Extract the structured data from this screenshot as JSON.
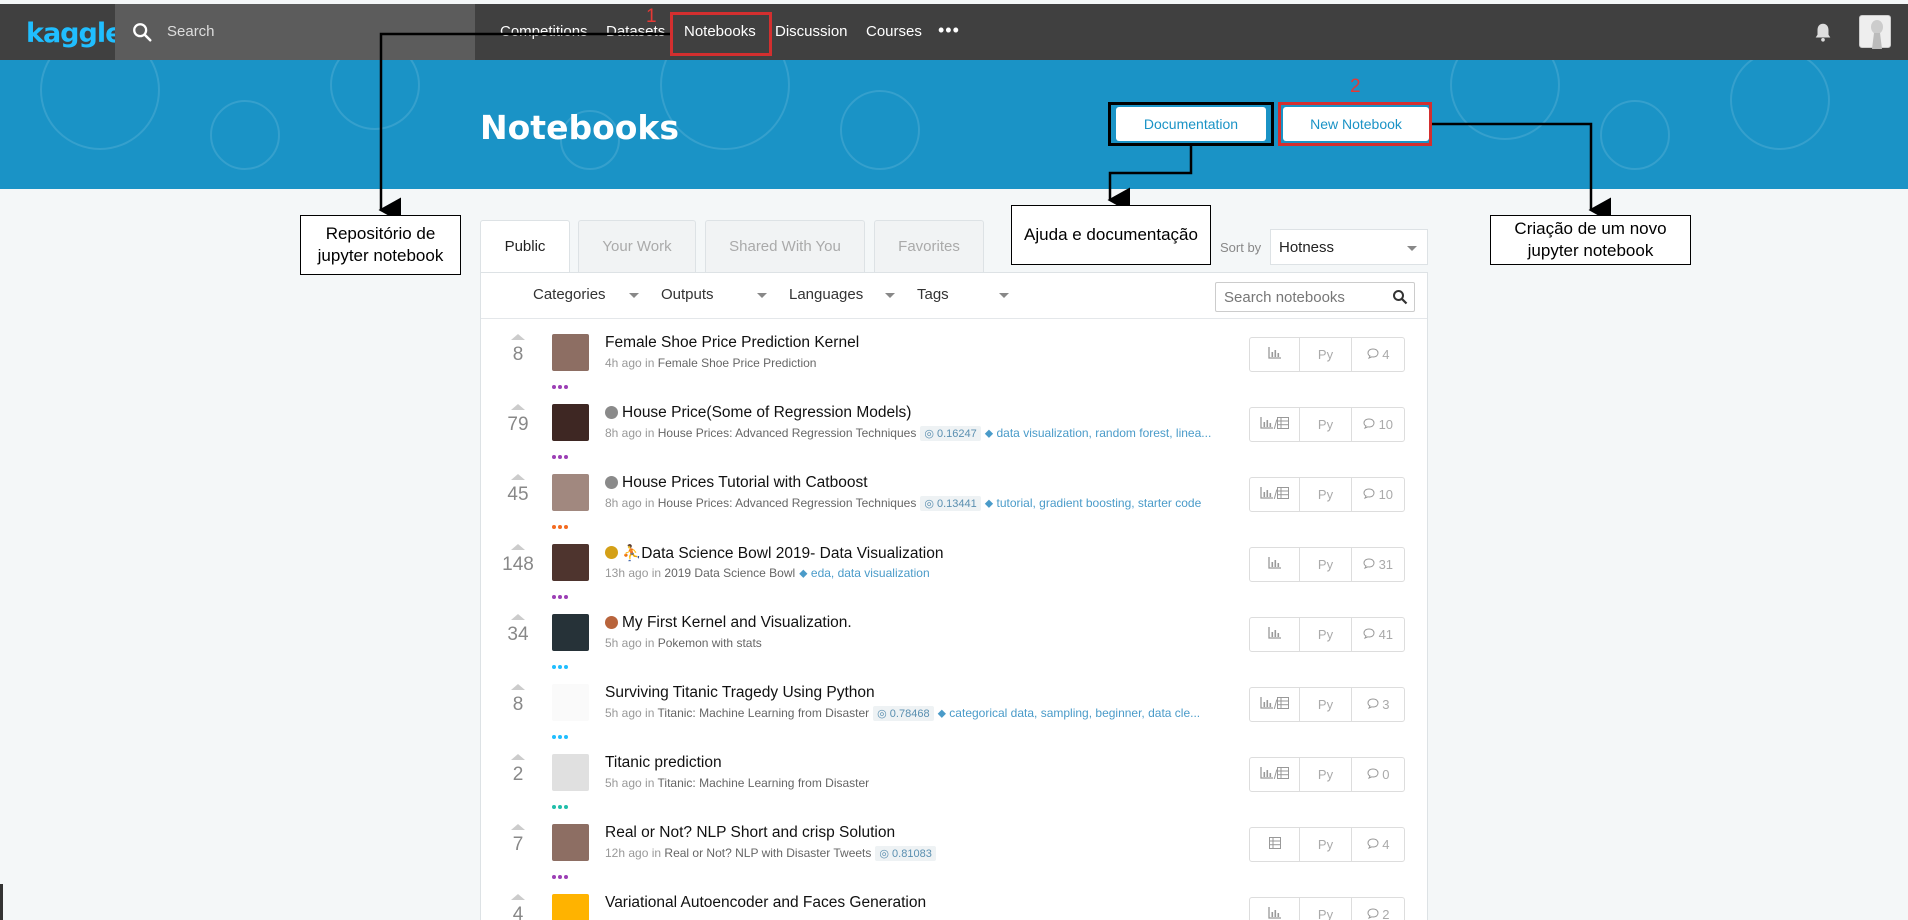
{
  "topbar": {
    "logo": "kaggle",
    "search_placeholder": "Search",
    "nav": [
      "Competitions",
      "Datasets",
      "Notebooks",
      "Discussion",
      "Courses"
    ],
    "more_label": "•••"
  },
  "hero": {
    "title": "Notebooks",
    "documentation_label": "Documentation",
    "new_notebook_label": "New Notebook"
  },
  "annotations": {
    "num1": "1",
    "num2": "2",
    "repo_line1": "Repositório de",
    "repo_line2": "jupyter notebook",
    "help": "Ajuda e documentação",
    "create_line1": "Criação de um novo",
    "create_line2": "jupyter notebook"
  },
  "tabs": [
    "Public",
    "Your Work",
    "Shared With You",
    "Favorites"
  ],
  "sort": {
    "label": "Sort by",
    "value": "Hotness"
  },
  "filters": [
    "Categories",
    "Outputs",
    "Languages",
    "Tags"
  ],
  "search_notebooks_placeholder": "Search notebooks",
  "notebooks": [
    {
      "votes": "8",
      "title": "Female Shoe Price Prediction Kernel",
      "time": "4h ago in",
      "competition": "Female Shoe Price Prediction",
      "score": "",
      "tags": "",
      "stats_icon": "chart",
      "lang": "Py",
      "comments": "4",
      "medal": "",
      "tier_color": "#9c3fb5"
    },
    {
      "votes": "79",
      "title": "House Price(Some of Regression Models)",
      "time": "8h ago in",
      "competition": "House Prices: Advanced Regression Techniques",
      "score": "0.16247",
      "tags": "data visualization, random forest, linea...",
      "stats_icon": "chart+table",
      "lang": "Py",
      "comments": "10",
      "medal": "silver",
      "tier_color": "#9c3fb5"
    },
    {
      "votes": "45",
      "title": "House Prices Tutorial with Catboost",
      "time": "8h ago in",
      "competition": "House Prices: Advanced Regression Techniques",
      "score": "0.13441",
      "tags": "tutorial, gradient boosting, starter code",
      "stats_icon": "chart+table",
      "lang": "Py",
      "comments": "10",
      "medal": "silver",
      "tier_color": "#f36b21"
    },
    {
      "votes": "148",
      "title": "⛹Data Science Bowl 2019- Data Visualization",
      "time": "13h ago in",
      "competition": "2019 Data Science Bowl",
      "score": "",
      "tags": "eda, data visualization",
      "stats_icon": "chart",
      "lang": "Py",
      "comments": "31",
      "medal": "gold",
      "tier_color": "#9c3fb5"
    },
    {
      "votes": "34",
      "title": "My First Kernel and Visualization.",
      "time": "5h ago in",
      "competition": "Pokemon with stats",
      "score": "",
      "tags": "",
      "stats_icon": "chart",
      "lang": "Py",
      "comments": "41",
      "medal": "bronze",
      "tier_color": "#20beff"
    },
    {
      "votes": "8",
      "title": "Surviving Titanic Tragedy Using Python",
      "time": "5h ago in",
      "competition": "Titanic: Machine Learning from Disaster",
      "score": "0.78468",
      "tags": "categorical data, sampling, beginner, data cle...",
      "stats_icon": "chart+table",
      "lang": "Py",
      "comments": "3",
      "medal": "",
      "tier_color": "#20beff"
    },
    {
      "votes": "2",
      "title": "Titanic prediction",
      "time": "5h ago in",
      "competition": "Titanic: Machine Learning from Disaster",
      "score": "",
      "tags": "",
      "stats_icon": "chart+table",
      "lang": "Py",
      "comments": "0",
      "medal": "",
      "tier_color": "#20beaa"
    },
    {
      "votes": "7",
      "title": "Real or Not? NLP Short and crisp Solution",
      "time": "12h ago in",
      "competition": "Real or Not? NLP with Disaster Tweets",
      "score": "0.81083",
      "tags": "",
      "stats_icon": "table",
      "lang": "Py",
      "comments": "4",
      "medal": "",
      "tier_color": "#9c3fb5"
    },
    {
      "votes": "4",
      "title": "Variational Autoencoder and Faces Generation",
      "time": "",
      "competition": "",
      "score": "",
      "tags": "",
      "stats_icon": "chart",
      "lang": "Py",
      "comments": "2",
      "medal": "",
      "tier_color": ""
    }
  ]
}
